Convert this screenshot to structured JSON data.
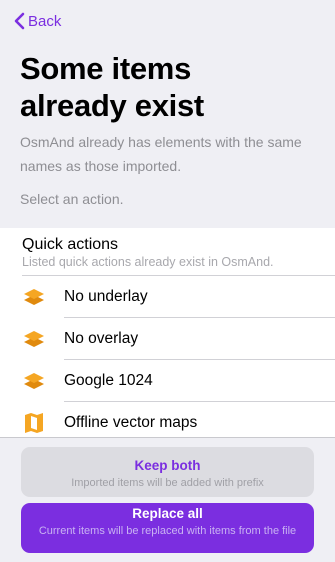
{
  "nav": {
    "back_label": "Back"
  },
  "header": {
    "title_line1": "Some items",
    "title_line2": "already exist",
    "description": "OsmAnd already has elements with the same names as those imported.",
    "action_hint": "Select an action."
  },
  "section": {
    "title": "Quick actions",
    "subtitle": "Listed quick actions already exist in OsmAnd."
  },
  "items": [
    {
      "label": "No underlay",
      "icon": "layers-icon"
    },
    {
      "label": "No overlay",
      "icon": "layers-icon"
    },
    {
      "label": "Google 1024",
      "icon": "layers-icon"
    },
    {
      "label": "Offline vector maps",
      "icon": "map-icon"
    }
  ],
  "actions": {
    "keep_both": {
      "title": "Keep both",
      "subtitle": "Imported items will be added with prefix"
    },
    "replace_all": {
      "title": "Replace all",
      "subtitle": "Current items will be replaced with items from the file"
    }
  },
  "colors": {
    "accent": "#7b2ee0",
    "icon_orange": "#f5a623",
    "background": "#efeff4"
  }
}
